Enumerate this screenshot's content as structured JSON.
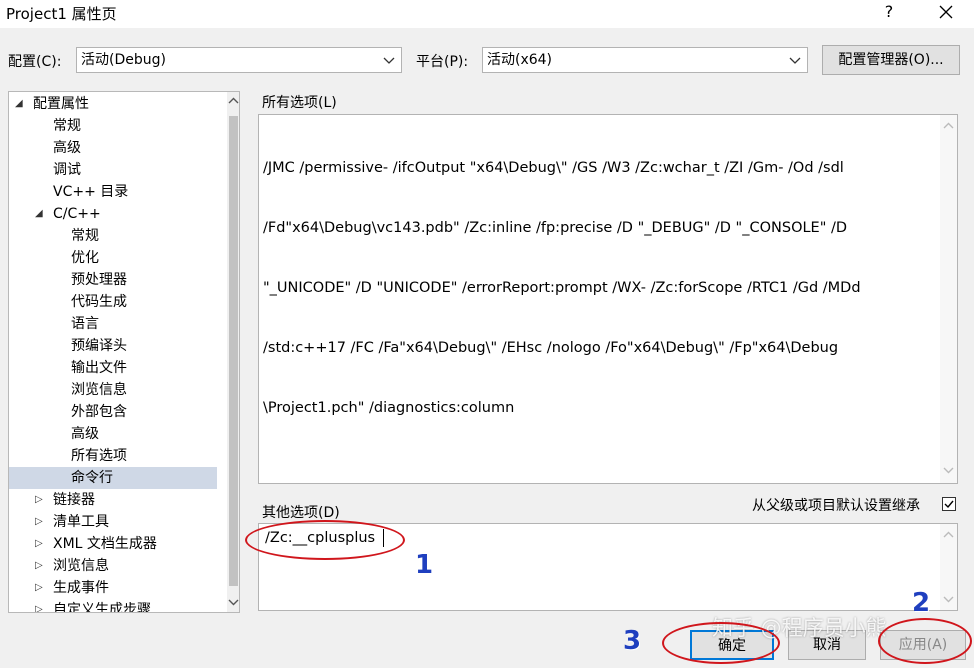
{
  "window": {
    "title": "Project1 属性页",
    "help": "?"
  },
  "config": {
    "label": "配置(C):",
    "value": "活动(Debug)"
  },
  "platform": {
    "label": "平台(P):",
    "value": "活动(x64)"
  },
  "config_manager_label": "配置管理器(O)...",
  "tree": {
    "items": [
      {
        "label": "配置属性",
        "expanded": true
      },
      {
        "label": "常规"
      },
      {
        "label": "高级"
      },
      {
        "label": "调试"
      },
      {
        "label": "VC++ 目录"
      },
      {
        "label": "C/C++",
        "expanded": true
      },
      {
        "label": "常规"
      },
      {
        "label": "优化"
      },
      {
        "label": "预处理器"
      },
      {
        "label": "代码生成"
      },
      {
        "label": "语言"
      },
      {
        "label": "预编译头"
      },
      {
        "label": "输出文件"
      },
      {
        "label": "浏览信息"
      },
      {
        "label": "外部包含"
      },
      {
        "label": "高级"
      },
      {
        "label": "所有选项"
      },
      {
        "label": "命令行",
        "selected": true
      },
      {
        "label": "链接器",
        "expanded": false
      },
      {
        "label": "清单工具",
        "expanded": false
      },
      {
        "label": "XML 文档生成器",
        "expanded": false
      },
      {
        "label": "浏览信息",
        "expanded": false
      },
      {
        "label": "生成事件",
        "expanded": false
      },
      {
        "label": "自定义生成步骤",
        "expanded": false
      }
    ]
  },
  "all_options": {
    "label": "所有选项(L)",
    "lines": [
      "/JMC /permissive- /ifcOutput \"x64\\Debug\\\" /GS /W3 /Zc:wchar_t /ZI /Gm- /Od /sdl",
      "/Fd\"x64\\Debug\\vc143.pdb\" /Zc:inline /fp:precise /D \"_DEBUG\" /D \"_CONSOLE\" /D",
      "\"_UNICODE\" /D \"UNICODE\" /errorReport:prompt /WX- /Zc:forScope /RTC1 /Gd /MDd",
      "/std:c++17 /FC /Fa\"x64\\Debug\\\" /EHsc /nologo /Fo\"x64\\Debug\\\" /Fp\"x64\\Debug",
      "\\Project1.pch\" /diagnostics:column"
    ]
  },
  "other_options": {
    "label": "其他选项(D)",
    "value": "/Zc:__cplusplus"
  },
  "inherit": {
    "label": "从父级或项目默认设置继承",
    "checked": true
  },
  "buttons": {
    "ok": "确定",
    "cancel": "取消",
    "apply": "应用(A)"
  },
  "annotations": {
    "n1": "1",
    "n2": "2",
    "n3": "3"
  },
  "watermark": "知乎 @程序员小熊",
  "colors": {
    "selection": "#cfd8e6",
    "annotation_circle": "#d0161c",
    "annotation_number": "#1f3fbf"
  }
}
